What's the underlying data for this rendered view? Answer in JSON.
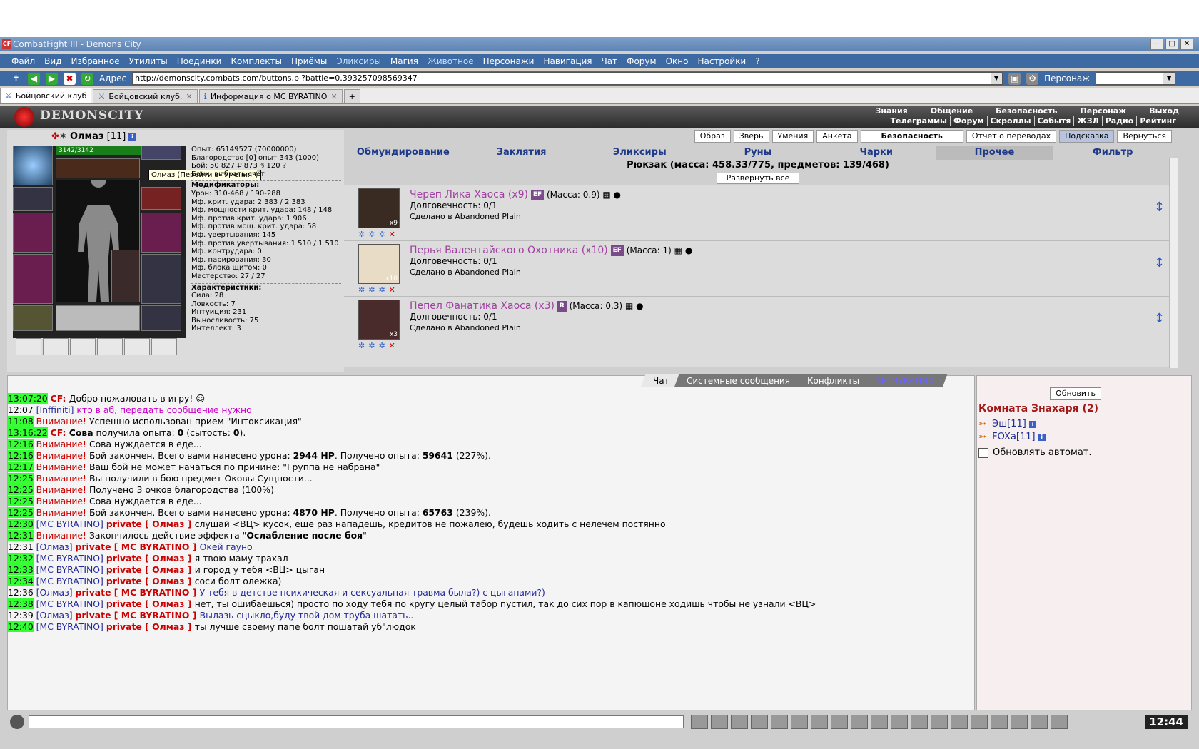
{
  "window": {
    "title": "CombatFight III - Demons City",
    "logo": "CF"
  },
  "menu": [
    "Файл",
    "Вид",
    "Избранное",
    "Утилиты",
    "Поединки",
    "Комплекты",
    "Приёмы",
    "Эликсиры",
    "Магия",
    "Животное",
    "Персонажи",
    "Навигация",
    "Чат",
    "Форум",
    "Окно",
    "Настройки",
    "?"
  ],
  "address": {
    "label": "Адрес",
    "url": "http://demonscity.combats.com/buttons.pl?battle=0.393257098569347",
    "persona_label": "Персонаж"
  },
  "browser_tabs": [
    {
      "label": "Бойцовский клуб"
    },
    {
      "label": "Бойцовский клуб."
    },
    {
      "label": "Информация о MC BYRATINO"
    }
  ],
  "header": {
    "logo": "DEMONSCITY",
    "nav1": [
      "Знания",
      "Общение",
      "Безопасность",
      "Персонаж",
      "Выход"
    ],
    "nav2": [
      "Телеграммы",
      "Форум",
      "Скроллы",
      "Событя",
      "ЖЗЛ",
      "Радио",
      "Рейтинг"
    ]
  },
  "character": {
    "name": "Олмаз",
    "level": "[11]",
    "hp": "3142/3142",
    "tooltip": "Олмаз (Перейти в \"Умения\")",
    "stats": [
      "Опыт: 65149527 (70000000)",
      "Благородство [0] опыт 343 (1000)",
      "Бой: 50 827  ₽ 873 ₰ 120 ?",
      "Банк: выбрать счёт"
    ],
    "mods_title": "Модификаторы:",
    "mods": [
      "Урон: 310-468 / 190-288",
      "Мф. крит. удара: 2 383 / 2 383",
      "Мф. мощности крит. удара: 148 / 148",
      "Мф. против крит. удара: 1 906",
      "Мф. против мощ. крит. удара: 58",
      "Мф. увертывания: 145",
      "Мф. против увертывания: 1 510 / 1 510",
      "Мф. контрудара: 0",
      "Мф. парирования: 30",
      "Мф. блока щитом: 0",
      "Мастерство: 27 / 27"
    ],
    "chars_title": "Характеристики:",
    "chars": [
      "Сила: 28",
      "Ловкость: 7",
      "Интуиция: 231",
      "Выносливость: 75",
      "Интеллект: 3"
    ]
  },
  "inventory": {
    "buttons": [
      "Образ",
      "Зверь",
      "Умения",
      "Анкета",
      "Безопасность",
      "Отчет о переводах",
      "Подсказка",
      "Вернуться"
    ],
    "categories": [
      "Обмундирование",
      "Заклятия",
      "Эликсиры",
      "Руны",
      "Чарки",
      "Прочее",
      "Фильтр"
    ],
    "backpack": "Рюкзак (масса: 458.33/775, предметов: 139/468)",
    "expand_all": "Развернуть всё",
    "items": [
      {
        "name": "Череп Лика Хаоса (x9)",
        "badge": "EF",
        "mass": "(Масса: 0.9)",
        "durability": "Долговечность: 0/1",
        "made": "Сделано в Abandoned Plain",
        "count": "x9",
        "color": "#3a2b22"
      },
      {
        "name": "Перья Валентайского Охотника (x10)",
        "badge": "EF",
        "mass": "(Масса: 1)",
        "durability": "Долговечность: 0/1",
        "made": "Сделано в Abandoned Plain",
        "count": "x10",
        "color": "#e9dcc6"
      },
      {
        "name": "Пепел Фанатика Хаоса (x3)",
        "badge": "R",
        "mass": "(Масса: 0.3)",
        "durability": "Долговечность: 0/1",
        "made": "Сделано в Abandoned Plain",
        "count": "x3",
        "color": "#4a2b2b"
      }
    ]
  },
  "chat": {
    "tabs": [
      "Чат",
      "Системные сообщения",
      "Конфликты",
      "MC BYRATINO"
    ],
    "lines": [
      {
        "t": "13:07:20",
        "g": true,
        "parts": [
          [
            "cf",
            "CF: "
          ],
          [
            "",
            "Добро пожаловать в игру! ☺"
          ]
        ]
      },
      {
        "t": "12:07",
        "g": false,
        "parts": [
          [
            "bl",
            "[Inffiniti] "
          ],
          [
            "pk",
            "кто в аб, передать сообщение нужно"
          ]
        ]
      },
      {
        "t": "11:08",
        "g": true,
        "parts": [
          [
            "w",
            "Внимание! "
          ],
          [
            "",
            "Успешно использован прием \"Интоксикация\""
          ]
        ]
      },
      {
        "t": "13:16:22",
        "g": true,
        "parts": [
          [
            "cf",
            "CF: "
          ],
          [
            "b",
            "Сова"
          ],
          [
            "",
            " получила опыта: "
          ],
          [
            "b",
            "0"
          ],
          [
            "",
            " (сытость: "
          ],
          [
            "b",
            "0"
          ],
          [
            "",
            "). "
          ]
        ]
      },
      {
        "t": "12:16",
        "g": true,
        "parts": [
          [
            "w",
            "Внимание! "
          ],
          [
            "",
            "Сова нуждается в еде..."
          ]
        ]
      },
      {
        "t": "12:16",
        "g": true,
        "parts": [
          [
            "w",
            "Внимание! "
          ],
          [
            "",
            "Бой закончен. Всего вами нанесено урона: "
          ],
          [
            "b",
            "2944 HP"
          ],
          [
            "",
            ". Получено опыта: "
          ],
          [
            "b",
            "59641"
          ],
          [
            "",
            " (227%)."
          ]
        ]
      },
      {
        "t": "12:17",
        "g": true,
        "parts": [
          [
            "w",
            "Внимание! "
          ],
          [
            "",
            "Ваш бой не может начаться по причине: \"Группа не набрана\""
          ]
        ]
      },
      {
        "t": "12:25",
        "g": true,
        "parts": [
          [
            "w",
            "Внимание! "
          ],
          [
            "",
            "Вы получили в бою предмет Оковы Сущности..."
          ]
        ]
      },
      {
        "t": "12:25",
        "g": true,
        "parts": [
          [
            "w",
            "Внимание! "
          ],
          [
            "",
            "Получено 3 очков благородства (100%)"
          ]
        ]
      },
      {
        "t": "12:25",
        "g": true,
        "parts": [
          [
            "w",
            "Внимание! "
          ],
          [
            "",
            "Сова нуждается в еде..."
          ]
        ]
      },
      {
        "t": "12:25",
        "g": true,
        "parts": [
          [
            "w",
            "Внимание! "
          ],
          [
            "",
            "Бой закончен. Всего вами нанесено урона: "
          ],
          [
            "b",
            "4870 HP"
          ],
          [
            "",
            ". Получено опыта: "
          ],
          [
            "b",
            "65763"
          ],
          [
            "",
            " (239%)."
          ]
        ]
      },
      {
        "t": "12:30",
        "g": true,
        "parts": [
          [
            "bl",
            "[MC BYRATINO] "
          ],
          [
            "pv",
            "private [ Олмаз ] "
          ],
          [
            "",
            "слушай <ВЦ> кусок, еще раз нападешь, кредитов не пожалею, будешь ходить с нелечем постянно"
          ]
        ]
      },
      {
        "t": "12:31",
        "g": true,
        "parts": [
          [
            "w",
            "Внимание! "
          ],
          [
            "",
            "Закончилось действие эффекта \""
          ],
          [
            "b",
            "Ослабление после боя"
          ],
          [
            "",
            "\""
          ]
        ]
      },
      {
        "t": "12:31",
        "g": false,
        "parts": [
          [
            "bl",
            "[Олмаз] "
          ],
          [
            "pv",
            "private [ MC BYRATINO ] "
          ],
          [
            "bl",
            "Окей гауно"
          ]
        ]
      },
      {
        "t": "12:32",
        "g": true,
        "parts": [
          [
            "bl",
            "[MC BYRATINO] "
          ],
          [
            "pv",
            "private [ Олмаз ] "
          ],
          [
            "",
            "я твою маму трахал"
          ]
        ]
      },
      {
        "t": "12:33",
        "g": true,
        "parts": [
          [
            "bl",
            "[MC BYRATINO] "
          ],
          [
            "pv",
            "private [ Олмаз ] "
          ],
          [
            "",
            "и город у тебя <ВЦ> цыган"
          ]
        ]
      },
      {
        "t": "12:34",
        "g": true,
        "parts": [
          [
            "bl",
            "[MC BYRATINO] "
          ],
          [
            "pv",
            "private [ Олмаз ] "
          ],
          [
            "",
            "соси болт олежка)"
          ]
        ]
      },
      {
        "t": "12:36",
        "g": false,
        "parts": [
          [
            "bl",
            "[Олмаз] "
          ],
          [
            "pv",
            "private [ MC BYRATINO ] "
          ],
          [
            "bl",
            "У тебя в детстве психическая и сексуальная травма была?) с цыганами?)"
          ]
        ]
      },
      {
        "t": "12:38",
        "g": true,
        "parts": [
          [
            "bl",
            "[MC BYRATINO] "
          ],
          [
            "pv",
            "private [ Олмаз ] "
          ],
          [
            "",
            "нет, ты ошибаешься) просто по ходу тебя по кругу целый табор пустил, так до сих пор в капюшоне ходишь чтобы не узнали <ВЦ>"
          ]
        ]
      },
      {
        "t": "12:39",
        "g": false,
        "parts": [
          [
            "bl",
            "[Олмаз] "
          ],
          [
            "pv",
            "private [ MC BYRATINO ] "
          ],
          [
            "bl",
            "Вылазь сцыкло,буду твой дом труба шатать.."
          ]
        ]
      },
      {
        "t": "12:40",
        "g": true,
        "parts": [
          [
            "bl",
            "[MC BYRATINO] "
          ],
          [
            "pv",
            "private [ Олмаз ] "
          ],
          [
            "",
            "ты лучше своему папе болт пошатай уб\"людок"
          ]
        ]
      }
    ]
  },
  "room": {
    "refresh": "Обновить",
    "title": "Комната Знахаря (2)",
    "users": [
      "Эш[11]",
      "FOXa[11]"
    ],
    "auto": "Обновлять автомат."
  },
  "clock": "12:44"
}
